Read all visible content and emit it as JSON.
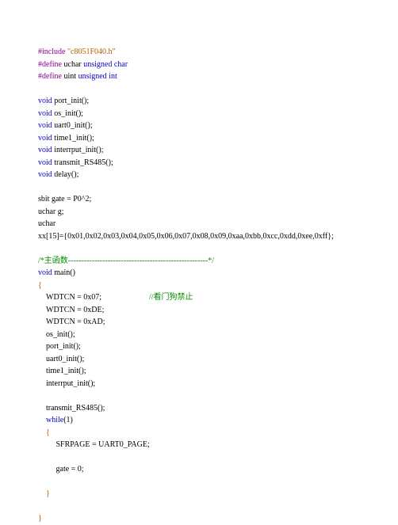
{
  "code": {
    "include_kw": "#include",
    "include_file": "\"c8051F040.h\"",
    "define_uchar_kw": "#define",
    "define_uchar_name": " uchar ",
    "define_uchar_type": "unsigned char",
    "define_uint_kw": "#define",
    "define_uint_name": " uint ",
    "define_uint_type": "unsigned int",
    "void1": "void",
    "decl_port_init": " port_init();",
    "void2": "void",
    "decl_os_init": " os_init();",
    "void3": "void",
    "decl_uart0_init": " uart0_init();",
    "void4": "void",
    "decl_time1_init": " time1_init();",
    "void5": "void",
    "decl_interrput_init": " interrput_init();",
    "void6": "void",
    "decl_transmit": " transmit_RS485();",
    "void7": "void",
    "decl_delay": " delay();",
    "sbit_line": "sbit gate = P0^2;",
    "uchar_g": "uchar g;",
    "uchar_only": "uchar",
    "xx_array": "xx[15]={0x01,0x02,0x03,0x04,0x05,0x06,0x07,0x08,0x09,0xaa,0xbb,0xcc,0xdd,0xee,0xff};",
    "cmt_main": "/*主函数-----------------------------------------------------*/",
    "void_main": "void",
    "main_decl": " main()",
    "brace_open1": "{",
    "body1": "    WDTCN = 0x07;\t\t\t",
    "cmt_wdt": "//看门狗禁止",
    "body2": "    WDTCN = 0xDE;",
    "body3": "    WDTCN = 0xAD;",
    "body4": "    os_init();",
    "body5": "    port_init();",
    "body6": "    uart0_init();",
    "body7": "    time1_init();",
    "body8": "    interrput_init();",
    "body_blank1": "",
    "body9": "    transmit_RS485();",
    "while_kw": "while",
    "while_rest": "(1)",
    "brace_open2": "    {",
    "body10": "         SFRPAGE = UART0_PAGE;",
    "body_blank2": "",
    "body11": "         gate = 0;",
    "body_blank3": "",
    "brace_close2": "    }",
    "body_blank4": "",
    "brace_close1": "}"
  }
}
